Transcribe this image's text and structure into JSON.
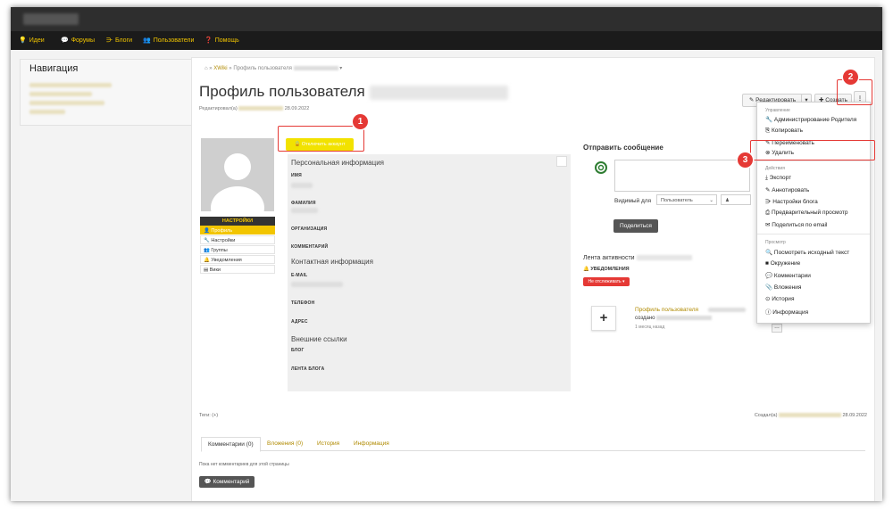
{
  "topnav": {
    "items": [
      {
        "icon": "lightbulb-icon",
        "glyph": "💡",
        "label": "Идеи"
      },
      {
        "icon": "chat-icon",
        "glyph": "💬",
        "label": "Форумы"
      },
      {
        "icon": "rss-icon",
        "glyph": "⋺",
        "label": "Блоги"
      },
      {
        "icon": "users-icon",
        "glyph": "👥",
        "label": "Пользователи"
      },
      {
        "icon": "help-icon",
        "glyph": "❓",
        "label": "Помощь"
      }
    ]
  },
  "sidebar": {
    "title": "Навигация"
  },
  "breadcrumb": {
    "home": "⌂",
    "space": "XWiki",
    "page": "Профиль пользователя"
  },
  "page": {
    "title": "Профиль пользователя",
    "edited_by_label": "Редактировал(а)",
    "edited_date": "28.09.2022"
  },
  "toolbar": {
    "edit_label": "✎ Редактировать",
    "caret": "▾",
    "create_label": "✚ Создать",
    "more_icon": "⋮"
  },
  "dropdown": {
    "sections": [
      {
        "title": "Управление",
        "items": [
          "🔧 Администрирование Родителя",
          "⎘ Копировать",
          "✎ Переименовать",
          "⊗ Удалить"
        ]
      },
      {
        "title": "Действия",
        "items": [
          "⤓ Экспорт",
          "✎ Аннотировать",
          "⋺ Настройки блога",
          "⎙ Предварительный просмотр",
          "✉ Поделиться по email"
        ]
      },
      {
        "title": "Просмотр",
        "items": [
          "🔍 Посмотреть исходный текст",
          "■ Окружение",
          "💬 Комментарии",
          "📎 Вложения",
          "⊙ История",
          "ⓘ Информация"
        ]
      }
    ]
  },
  "profile": {
    "disable_button": "🔒 Отключить аккаунт",
    "settings_header": "НАСТРОЙКИ",
    "settings_items": [
      {
        "label": "👤 Профиль",
        "active": true
      },
      {
        "label": "🔧 Настройки",
        "active": false
      },
      {
        "label": "👥 Группы",
        "active": false
      },
      {
        "label": "🔔 Уведомления",
        "active": false
      },
      {
        "label": "▤ Вики",
        "active": false
      }
    ],
    "personal_title": "Персональная информация",
    "first_name_label": "ИМЯ",
    "last_name_label": "ФАМИЛИЯ",
    "organization_label": "ОРГАНИЗАЦИЯ",
    "comment_label": "КОММЕНТАРИЙ",
    "contact_title": "Контактная информация",
    "email_label": "E-MAIL",
    "phone_label": "ТЕЛЕФОН",
    "address_label": "АДРЕС",
    "external_title": "Внешние ссылки",
    "blog_label": "БЛОГ",
    "blog_feed_label": "ЛЕНТА БЛОГА"
  },
  "message": {
    "title": "Отправить сообщение",
    "visible_label": "Видимый для",
    "visibility_value": "Пользователь",
    "share_button": "Поделиться"
  },
  "activity": {
    "title": "Лента активности",
    "notifications_label": "🔔 УВЕДОМЛЕНИЯ",
    "unwatch_button": "Не отслеживать ▾",
    "entry_title": "Профиль пользователя",
    "entry_created": "создано",
    "entry_time": "1 месяц назад"
  },
  "footer": {
    "tags_label": "Теги: (+)",
    "created_label": "Создал(а)",
    "created_date": "28.09.2022"
  },
  "tabs": [
    {
      "label": "Комментарии (0)",
      "active": true
    },
    {
      "label": "Вложения (0)",
      "active": false
    },
    {
      "label": "История",
      "active": false
    },
    {
      "label": "Информация",
      "active": false
    }
  ],
  "comments": {
    "empty_text": "Пока нет комментариев для этой страницы",
    "add_button": "💬 Комментарий"
  },
  "annotations": [
    "1",
    "2",
    "3"
  ],
  "colors": {
    "accent": "#f2c500",
    "highlight": "#e53935",
    "menubar": "#1b1b1b"
  }
}
